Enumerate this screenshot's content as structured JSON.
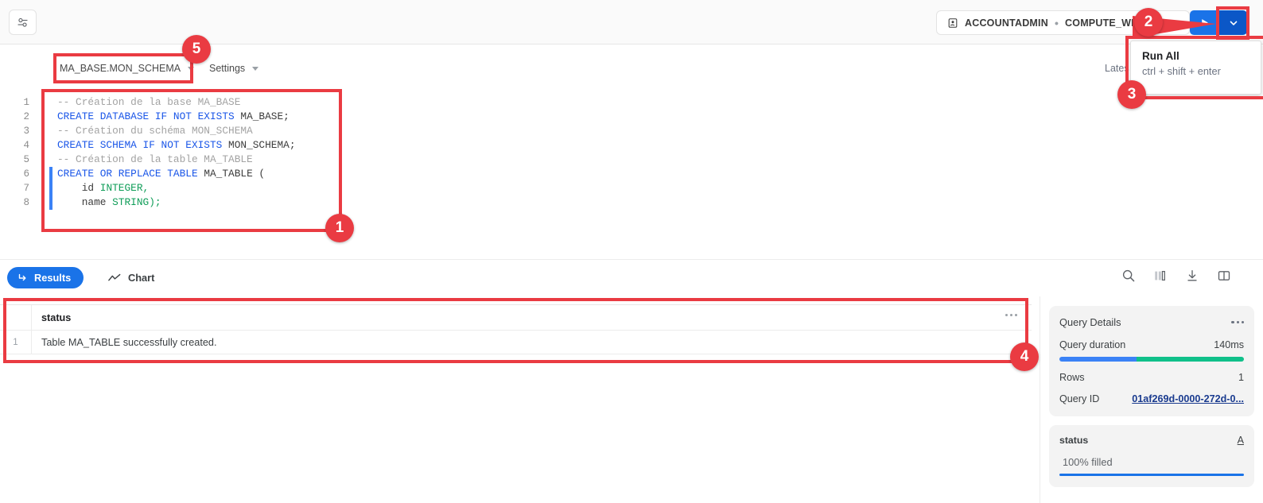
{
  "topbar": {
    "sliders_icon": "sliders-icon",
    "context_role": "ACCOUNTADMIN",
    "context_sep": "•",
    "context_warehouse": "COMPUTE_WH",
    "run_icon": "play-icon",
    "run_caret_icon": "chevron-down-icon"
  },
  "editor_toolbar": {
    "schema": "MA_BASE.MON_SCHEMA",
    "settings": "Settings",
    "latest": "Lates"
  },
  "editor": {
    "line_numbers": [
      "1",
      "2",
      "3",
      "4",
      "5",
      "6",
      "7",
      "8"
    ],
    "lines": [
      {
        "segments": [
          {
            "t": "-- Création de la base MA_BASE",
            "c": "c-comment"
          }
        ]
      },
      {
        "segments": [
          {
            "t": "CREATE DATABASE IF NOT EXISTS ",
            "c": "c-kw"
          },
          {
            "t": "MA_BASE;",
            "c": "c-id"
          }
        ]
      },
      {
        "segments": [
          {
            "t": "-- Création du schéma MON_SCHEMA",
            "c": "c-comment"
          }
        ]
      },
      {
        "segments": [
          {
            "t": "CREATE SCHEMA IF NOT EXISTS ",
            "c": "c-kw"
          },
          {
            "t": "MON_SCHEMA;",
            "c": "c-id"
          }
        ]
      },
      {
        "segments": [
          {
            "t": "-- Création de la table MA_TABLE",
            "c": "c-comment"
          }
        ]
      },
      {
        "segments": [
          {
            "t": "CREATE OR REPLACE TABLE ",
            "c": "c-kw"
          },
          {
            "t": "MA_TABLE (",
            "c": "c-id"
          }
        ]
      },
      {
        "segments": [
          {
            "t": "    id ",
            "c": "c-id"
          },
          {
            "t": "INTEGER,",
            "c": "c-type"
          }
        ]
      },
      {
        "segments": [
          {
            "t": "    name ",
            "c": "c-id"
          },
          {
            "t": "STRING);",
            "c": "c-type"
          }
        ]
      }
    ]
  },
  "results_tabs": {
    "results_label": "Results",
    "results_icon": "return-arrow-icon",
    "chart_label": "Chart",
    "chart_icon": "line-chart-icon",
    "icons": [
      "search-icon",
      "columns-icon",
      "download-icon",
      "split-panel-icon"
    ]
  },
  "result_grid": {
    "columns": [
      "status"
    ],
    "rows": [
      {
        "index": "1",
        "status": "Table MA_TABLE successfully created."
      }
    ]
  },
  "query_details": {
    "title": "Query Details",
    "duration_label": "Query duration",
    "duration_value": "140ms",
    "duration_bar_blue_pct": 42,
    "duration_bar_green_pct": 58,
    "rows_label": "Rows",
    "rows_value": "1",
    "query_id_label": "Query ID",
    "query_id_value": "01af269d-0000-272d-0...",
    "status_card": {
      "name": "status",
      "type_glyph": "A",
      "value": "100% filled"
    }
  },
  "tooltip": {
    "title": "Run All",
    "shortcut": "ctrl + shift + enter"
  },
  "annotations": {
    "markers": [
      {
        "id": "1",
        "label": "1"
      },
      {
        "id": "2",
        "label": "2"
      },
      {
        "id": "3",
        "label": "3"
      },
      {
        "id": "4",
        "label": "4"
      },
      {
        "id": "5",
        "label": "5"
      }
    ]
  },
  "colors": {
    "accent_blue": "#1a73e8",
    "dark_blue": "#0b57c7",
    "annotation_red": "#ea3b42",
    "bar_blue": "#3b82f6",
    "bar_green": "#10c08a",
    "comment_gray": "#a3a3a3",
    "keyword_blue": "#1a56e8",
    "type_green": "#0f9d58"
  }
}
